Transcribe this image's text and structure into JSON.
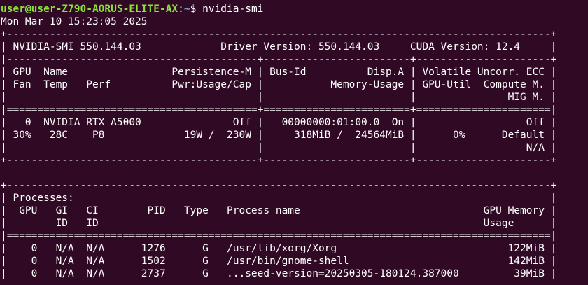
{
  "prompt": {
    "user_host": "user@user-Z790-AORUS-ELITE-AX",
    "separator": ":",
    "path": "~",
    "symbol": "$",
    "command": " nvidia-smi"
  },
  "output": {
    "timestamp": "Mon Mar 10 15:23:05 2025",
    "table_lines": [
      "+-----------------------------------------------------------------------------------------+",
      "| NVIDIA-SMI 550.144.03             Driver Version: 550.144.03     CUDA Version: 12.4     |",
      "|-----------------------------------------+------------------------+----------------------+",
      "| GPU  Name                 Persistence-M | Bus-Id          Disp.A | Volatile Uncorr. ECC |",
      "| Fan  Temp   Perf          Pwr:Usage/Cap |           Memory-Usage | GPU-Util  Compute M. |",
      "|                                         |                        |               MIG M. |",
      "|=========================================+========================+======================|",
      "|   0  NVIDIA RTX A5000               Off |   00000000:01:00.0  On |                  Off |",
      "| 30%   28C    P8             19W /  230W |     318MiB /  24564MiB |      0%      Default |",
      "|                                         |                        |                  N/A |",
      "+-----------------------------------------+------------------------+----------------------+",
      "",
      "+-----------------------------------------------------------------------------------------+",
      "| Processes:                                                                              |",
      "|  GPU   GI   CI        PID   Type   Process name                              GPU Memory |",
      "|        ID   ID                                                               Usage      |",
      "|=========================================================================================|",
      "|    0   N/A  N/A      1276      G   /usr/lib/xorg/Xorg                            122MiB |",
      "|    0   N/A  N/A      1502      G   /usr/bin/gnome-shell                          142MiB |",
      "|    0   N/A  N/A      2737      G   ...seed-version=20250305-180124.387000         39MiB |"
    ]
  }
}
